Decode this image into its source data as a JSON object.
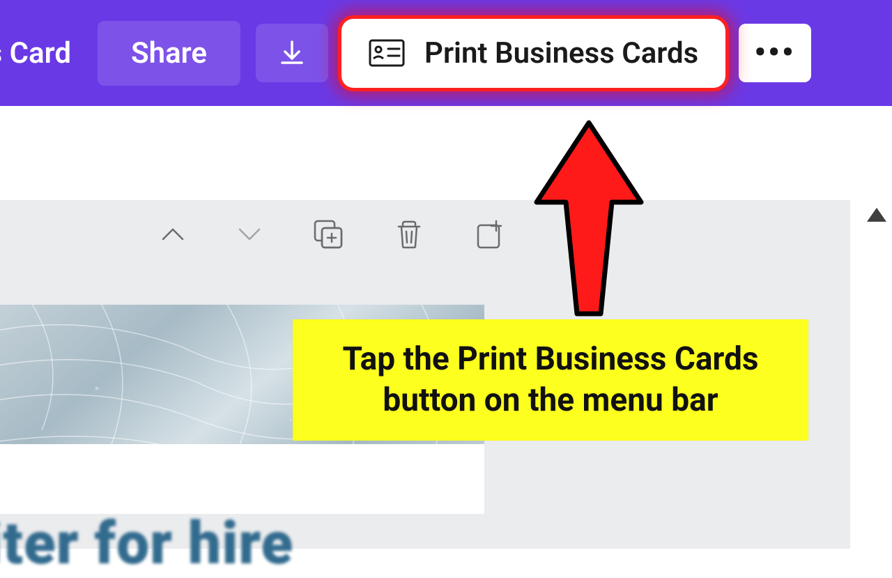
{
  "colors": {
    "topbar": "#6a39e6",
    "highlight": "#ff2020",
    "callout_bg": "#fdff1e",
    "hero_text": "#326b8e"
  },
  "topbar": {
    "doc_title_fragment": "ss Card",
    "share_label": "Share",
    "print_label": "Print Business Cards"
  },
  "canvas": {
    "hero_text_fragment": "iter for hire"
  },
  "annotation": {
    "callout_line1": "Tap the Print Business Cards",
    "callout_line2": "button on the menu bar"
  }
}
